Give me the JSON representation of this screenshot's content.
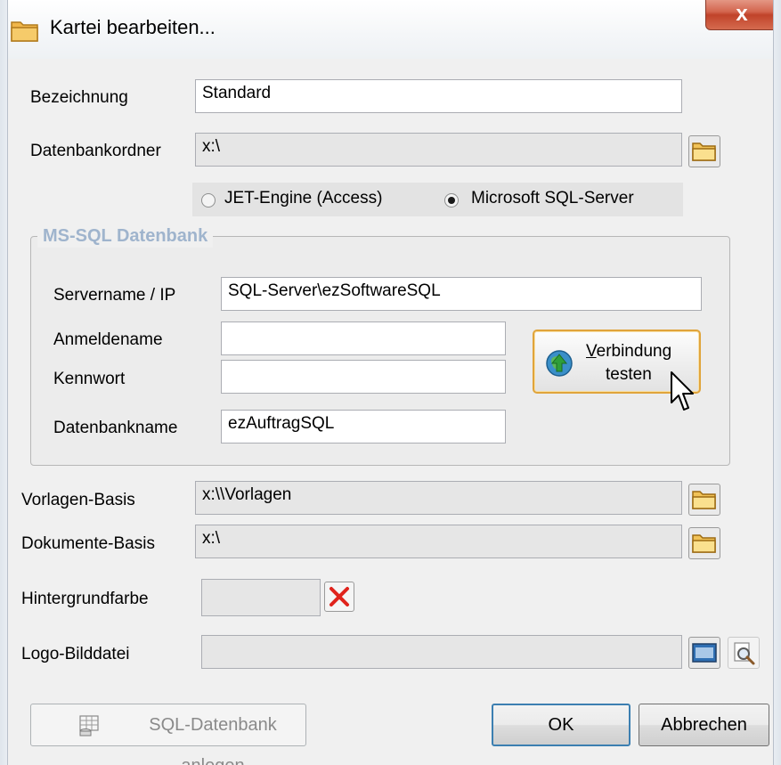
{
  "window": {
    "title": "Kartei bearbeiten...",
    "close_label": "x"
  },
  "form": {
    "bezeichnung": {
      "label": "Bezeichnung",
      "value": "Standard"
    },
    "datenbankordner": {
      "label": "Datenbankordner",
      "value": "x:\\"
    },
    "engine": {
      "options": [
        "JET-Engine (Access)",
        "Microsoft SQL-Server"
      ],
      "selected": "Microsoft SQL-Server"
    }
  },
  "mssql": {
    "legend": "MS-SQL Datenbank",
    "servername": {
      "label": "Servername / IP",
      "value": "SQL-Server\\ezSoftwareSQL"
    },
    "anmeldename": {
      "label": "Anmeldename",
      "value": ""
    },
    "kennwort": {
      "label": "Kennwort",
      "value": ""
    },
    "datenbankname": {
      "label": "Datenbankname",
      "value": "ezAuftragSQL"
    },
    "test_button": {
      "line1_accel": "V",
      "line1_rest": "erbindung",
      "line2": "testen"
    }
  },
  "paths": {
    "vorlagen": {
      "label": "Vorlagen-Basis",
      "value": "x:\\\\Vorlagen"
    },
    "dokumente": {
      "label": "Dokumente-Basis",
      "value": "x:\\"
    },
    "hintergrundfarbe": {
      "label": "Hintergrundfarbe",
      "value": ""
    },
    "logo": {
      "label": "Logo-Bilddatei",
      "value": ""
    }
  },
  "footer": {
    "sql_create_label": "SQL-Datenbank anlegen",
    "ok_label": "OK",
    "cancel_label": "Abbrechen"
  },
  "colors": {
    "accent_orange": "#e0a43b",
    "legend_blue": "#9fb4cd",
    "close_red": "#c0432a"
  },
  "icons": {
    "title": "folder-icon",
    "browse": "folder-icon",
    "connection": "globe-icon",
    "clear_color": "red-x-icon",
    "image": "image-icon",
    "preview": "magnifier-icon",
    "database": "database-icon"
  }
}
